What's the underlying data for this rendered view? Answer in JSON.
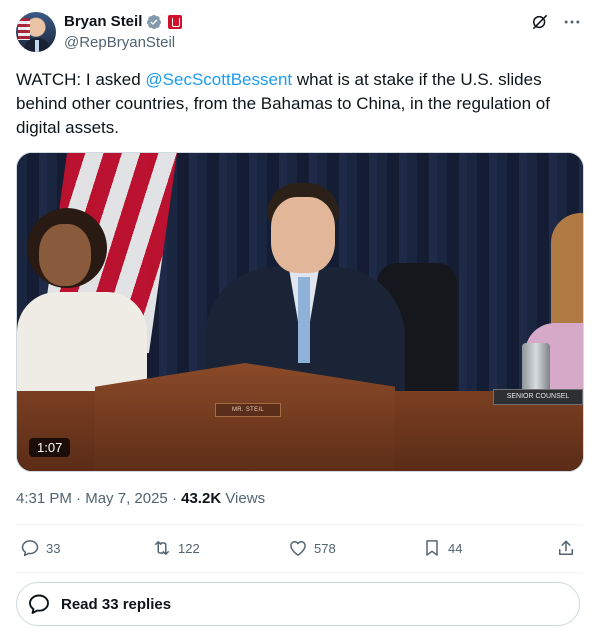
{
  "author": {
    "name": "Bryan Steil",
    "handle": "@RepBryanSteil"
  },
  "tweet": {
    "text_before": "WATCH: I asked ",
    "mention": "@SecScottBessent",
    "text_after": "  what is at stake if the U.S. slides behind other countries, from the Bahamas to China, in the regulation of digital assets."
  },
  "video": {
    "duration": "1:07",
    "nameplate_center": "MR. STEIL",
    "nameplate_right": "SENIOR COUNSEL"
  },
  "meta": {
    "time": "4:31 PM",
    "separator": "·",
    "date": "May 7, 2025",
    "views_count": "43.2K",
    "views_label": "Views"
  },
  "actions": {
    "replies": "33",
    "reposts": "122",
    "likes": "578",
    "bookmarks": "44"
  },
  "read_replies_label": "Read 33 replies",
  "colors": {
    "link": "#1d9bf0",
    "secondary_text": "#536471",
    "primary_text": "#0f1419",
    "gov_badge": "#d0112b"
  }
}
